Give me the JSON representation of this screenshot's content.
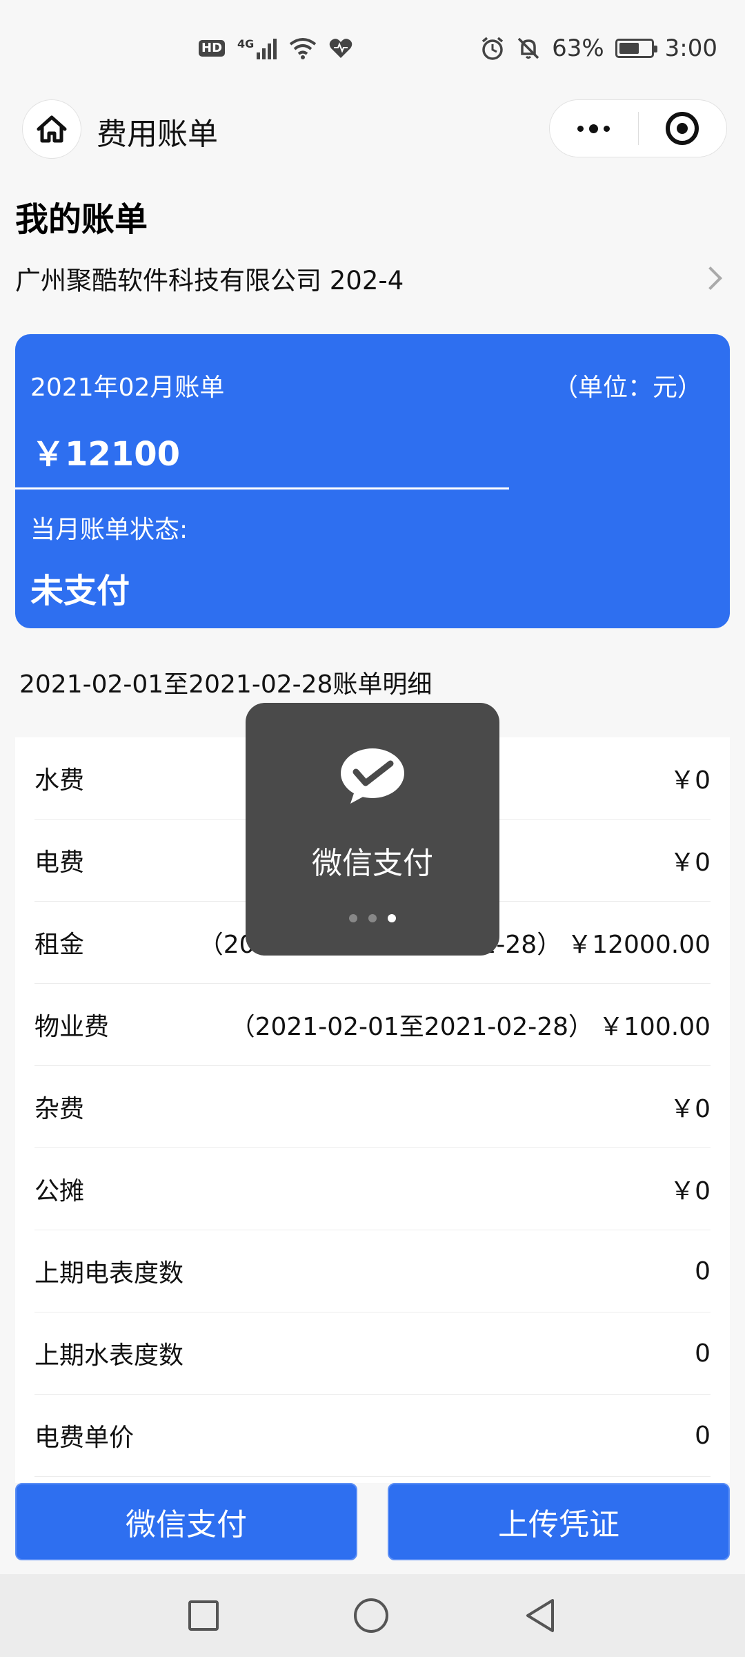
{
  "status_bar": {
    "hd": "HD",
    "network": "4G",
    "battery_percent": "63%",
    "battery_level": 0.63,
    "time": "3:00",
    "icons": [
      "hd-icon",
      "signal-icon",
      "wifi-icon",
      "heart-icon",
      "alarm-icon",
      "mute-icon",
      "battery-icon"
    ]
  },
  "nav": {
    "title": "费用账单",
    "home_icon": "home-icon",
    "more_icon": "more-dots-icon",
    "close_icon": "target-icon"
  },
  "section": {
    "heading": "我的账单",
    "company": "广州聚酷软件科技有限公司 202-4"
  },
  "card": {
    "month": "2021年02月账单",
    "unit": "（单位：元）",
    "amount": "￥12100",
    "status_label": "当月账单状态:",
    "status_value": "未支付"
  },
  "period_title": "2021-02-01至2021-02-28账单明细",
  "details": [
    {
      "name": "水费",
      "range": "",
      "amount": "￥0"
    },
    {
      "name": "电费",
      "range": "",
      "amount": "￥0"
    },
    {
      "name": "租金",
      "range": "（2021-02-01至2021-02-28）",
      "amount": "￥12000.00"
    },
    {
      "name": "物业费",
      "range": "（2021-02-01至2021-02-28）",
      "amount": "￥100.00"
    },
    {
      "name": "杂费",
      "range": "",
      "amount": "￥0"
    },
    {
      "name": "公摊",
      "range": "",
      "amount": "￥0"
    },
    {
      "name": "上期电表度数",
      "range": "",
      "amount": "0"
    },
    {
      "name": "上期水表度数",
      "range": "",
      "amount": "0"
    },
    {
      "name": "电费单价",
      "range": "",
      "amount": "0"
    }
  ],
  "toast": {
    "text": "微信支付",
    "icon": "wechat-pay-icon",
    "dots": 3,
    "active_dot": 3
  },
  "buttons": {
    "pay": "微信支付",
    "upload": "上传凭证"
  },
  "colors": {
    "accent": "#2e6ff0",
    "toast_bg": "#4a4a4a",
    "page_bg": "#f7f7f7"
  }
}
